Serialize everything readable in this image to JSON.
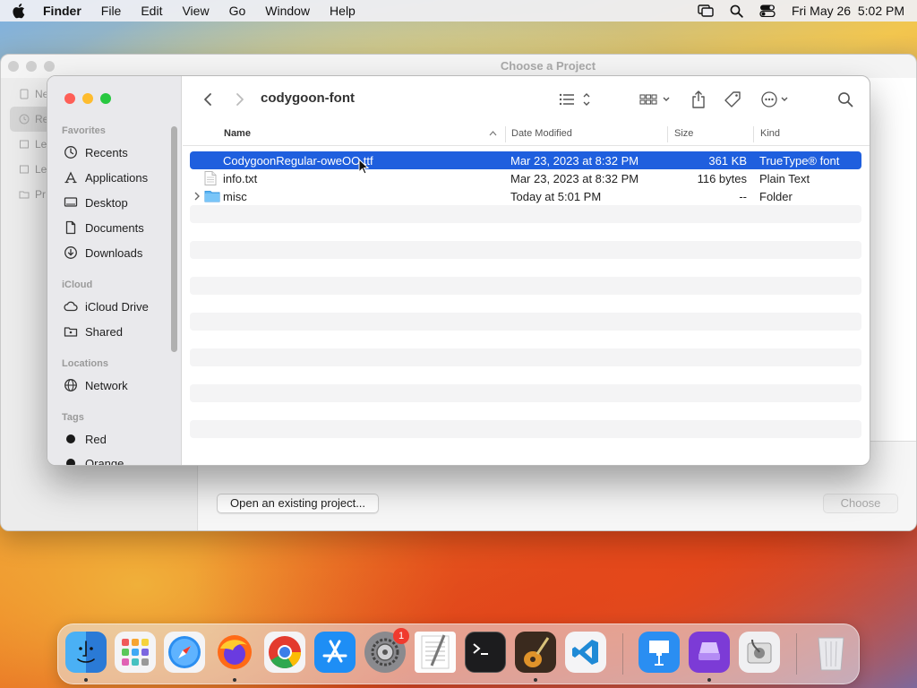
{
  "menubar": {
    "app": "Finder",
    "items": [
      "File",
      "Edit",
      "View",
      "Go",
      "Window",
      "Help"
    ],
    "clock": "Fri May 26  5:02 PM"
  },
  "background_window": {
    "title": "Choose a Project",
    "sidebar_items": [
      "Ne",
      "Re",
      "Le",
      "Le",
      "Pr"
    ],
    "open_button": "Open an existing project...",
    "choose_button": "Choose"
  },
  "finder": {
    "folder_title": "codygoon-font",
    "sidebar": {
      "favorites_label": "Favorites",
      "favorites": [
        {
          "label": "Recents",
          "icon": "clock-icon"
        },
        {
          "label": "Applications",
          "icon": "applications-icon"
        },
        {
          "label": "Desktop",
          "icon": "desktop-icon"
        },
        {
          "label": "Documents",
          "icon": "document-icon"
        },
        {
          "label": "Downloads",
          "icon": "download-icon"
        }
      ],
      "icloud_label": "iCloud",
      "icloud": [
        {
          "label": "iCloud Drive",
          "icon": "cloud-icon"
        },
        {
          "label": "Shared",
          "icon": "shared-folder-icon"
        }
      ],
      "locations_label": "Locations",
      "locations": [
        {
          "label": "Network",
          "icon": "globe-icon"
        }
      ],
      "tags_label": "Tags",
      "tags": [
        {
          "label": "Red",
          "color": "#1a1a1a"
        },
        {
          "label": "Orange",
          "color": "#1a1a1a"
        }
      ]
    },
    "columns": {
      "name": "Name",
      "date": "Date Modified",
      "size": "Size",
      "kind": "Kind"
    },
    "files": [
      {
        "name": "CodygoonRegular-oweOO.ttf",
        "date": "Mar 23, 2023 at 8:32 PM",
        "size": "361 KB",
        "kind": "TrueType® font",
        "selected": true
      },
      {
        "name": "info.txt",
        "date": "Mar 23, 2023 at 8:32 PM",
        "size": "116 bytes",
        "kind": "Plain Text",
        "selected": false
      },
      {
        "name": "misc",
        "date": "Today at 5:01 PM",
        "size": "--",
        "kind": "Folder",
        "selected": false
      }
    ]
  },
  "dock": {
    "apps": [
      "finder-icon",
      "launchpad-icon",
      "safari-icon",
      "firefox-icon",
      "chrome-icon",
      "app-store-icon",
      "system-settings-icon",
      "textedit-icon",
      "terminal-icon",
      "garageband-icon",
      "vscode-icon",
      "keynote-icon",
      "simulator-icon",
      "disk-utility-icon",
      "trash-icon"
    ],
    "settings_badge": "1"
  },
  "colors": {
    "selection": "#1f5fde",
    "close": "#fe5f57",
    "minimize": "#febc2e",
    "zoom": "#28c840"
  }
}
